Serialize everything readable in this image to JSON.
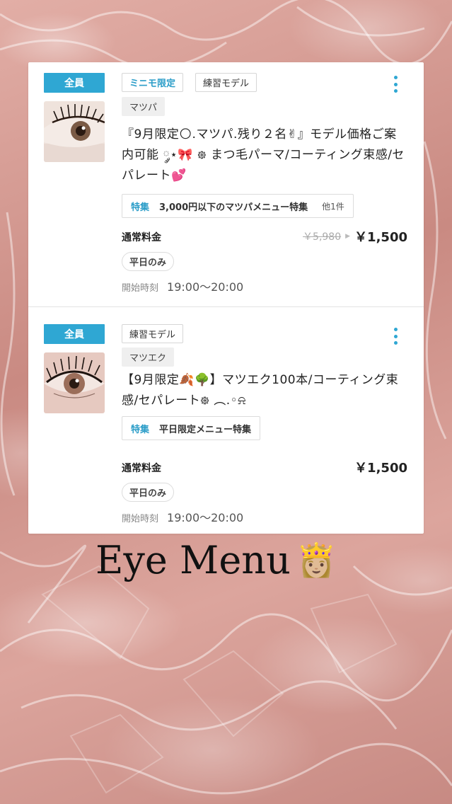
{
  "cards": [
    {
      "badge": "全員",
      "tags_row1": [
        "ミニモ限定",
        "練習モデル"
      ],
      "tags_row2": [
        "マツパ"
      ],
      "title": "『9月限定🌕.マツパ.残り２名✌︎』モデル価格ご案内可能 ༘⋆🎀 ᪥ まつ毛パーマ/コーティング束感/セパレート💕",
      "feature": {
        "label": "特集",
        "text": "3,000円以下のマツパメニュー特集",
        "more": "他1件"
      },
      "price_label": "通常料金",
      "old_price": "￥5,980",
      "price": "￥1,500",
      "weekday": "平日のみ",
      "start_label": "開始時刻",
      "start_time": "19:00〜20:00"
    },
    {
      "badge": "全員",
      "tags_row1": [
        "練習モデル"
      ],
      "tags_row2": [
        "マツエク"
      ],
      "title": "【9月限定🍂🌳】マツエク100本/コーティング束感/セパレート᪥ ︵.◦⍾",
      "feature": {
        "label": "特集",
        "text": "平日限定メニュー特集"
      },
      "price_label": "通常料金",
      "price": "￥1,500",
      "weekday": "平日のみ",
      "start_label": "開始時刻",
      "start_time": "19:00〜20:00"
    }
  ],
  "caption": {
    "text": "Eye Menu",
    "emoji": "👸🏼"
  },
  "colors": {
    "accent": "#2fa7d3",
    "background": "#d9a19a"
  },
  "icons": {
    "more": "more-vertical-icon",
    "arrow": "arrow-right-icon"
  }
}
